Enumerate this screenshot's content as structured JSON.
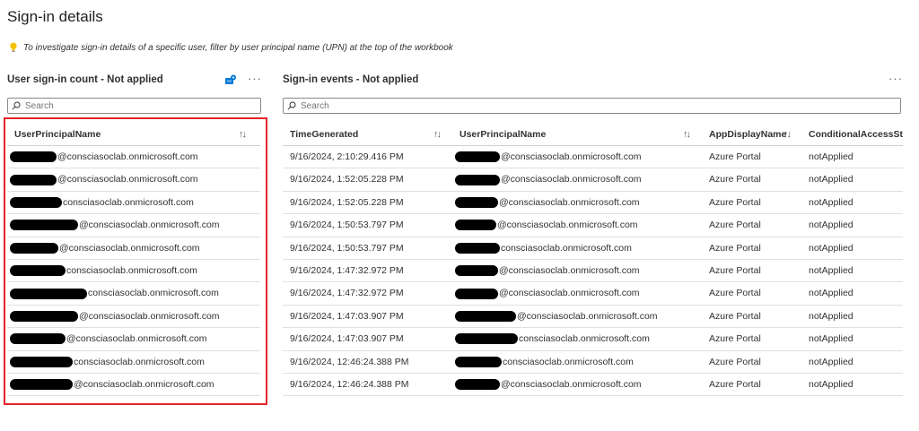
{
  "page": {
    "title": "Sign-in details",
    "tip": "To investigate sign-in details of a specific user, filter by user principal name (UPN) at the top of the workbook"
  },
  "left_panel": {
    "title": "User sign-in count - Not applied",
    "more": "···",
    "search_placeholder": "Search",
    "column": "UserPrincipalName",
    "sort_icon": "↑↓",
    "rows": [
      {
        "domain": "@consciasoclab.onmicrosoft.com"
      },
      {
        "domain": "@consciasoclab.onmicrosoft.com"
      },
      {
        "domain": "consciasoclab.onmicrosoft.com"
      },
      {
        "domain": "@consciasoclab.onmicrosoft.com"
      },
      {
        "domain": "@consciasoclab.onmicrosoft.com"
      },
      {
        "domain": "consciasoclab.onmicrosoft.com"
      },
      {
        "domain": "consciasoclab.onmicrosoft.com"
      },
      {
        "domain": "@consciasoclab.onmicrosoft.com"
      },
      {
        "domain": "@consciasoclab.onmicrosoft.com"
      },
      {
        "domain": "consciasoclab.onmicrosoft.com"
      },
      {
        "domain": "@consciasoclab.onmicrosoft.com"
      }
    ]
  },
  "right_panel": {
    "title": "Sign-in events - Not applied",
    "more": "···",
    "search_placeholder": "Search",
    "columns": {
      "time": "TimeGenerated",
      "upn": "UserPrincipalName",
      "app": "AppDisplayName",
      "ca": "ConditionalAccessStat"
    },
    "sort_icon": "↑↓",
    "rows": [
      {
        "time": "9/16/2024, 2:10:29.416 PM",
        "domain": "@consciasoclab.onmicrosoft.com",
        "app": "Azure Portal",
        "ca": "notApplied"
      },
      {
        "time": "9/16/2024, 1:52:05.228 PM",
        "domain": "@consciasoclab.onmicrosoft.com",
        "app": "Azure Portal",
        "ca": "notApplied"
      },
      {
        "time": "9/16/2024, 1:52:05.228 PM",
        "domain": "@consciasoclab.onmicrosoft.com",
        "app": "Azure Portal",
        "ca": "notApplied"
      },
      {
        "time": "9/16/2024, 1:50:53.797 PM",
        "domain": "@consciasoclab.onmicrosoft.com",
        "app": "Azure Portal",
        "ca": "notApplied"
      },
      {
        "time": "9/16/2024, 1:50:53.797 PM",
        "domain": "consciasoclab.onmicrosoft.com",
        "app": "Azure Portal",
        "ca": "notApplied"
      },
      {
        "time": "9/16/2024, 1:47:32.972 PM",
        "domain": "@consciasoclab.onmicrosoft.com",
        "app": "Azure Portal",
        "ca": "notApplied"
      },
      {
        "time": "9/16/2024, 1:47:32.972 PM",
        "domain": "@consciasoclab.onmicrosoft.com",
        "app": "Azure Portal",
        "ca": "notApplied"
      },
      {
        "time": "9/16/2024, 1:47:03.907 PM",
        "domain": "@consciasoclab.onmicrosoft.com",
        "app": "Azure Portal",
        "ca": "notApplied"
      },
      {
        "time": "9/16/2024, 1:47:03.907 PM",
        "domain": "consciasoclab.onmicrosoft.com",
        "app": "Azure Portal",
        "ca": "notApplied"
      },
      {
        "time": "9/16/2024, 12:46:24.388 PM",
        "domain": "consciasoclab.onmicrosoft.com",
        "app": "Azure Portal",
        "ca": "notApplied"
      },
      {
        "time": "9/16/2024, 12:46:24.388 PM",
        "domain": "@consciasoclab.onmicrosoft.com",
        "app": "Azure Portal",
        "ca": "notApplied"
      }
    ]
  },
  "colors": {
    "highlight": "#e3232b",
    "redaction": "#000000",
    "tip_icon": "#f2c200",
    "workspace_icon": "#0078d4"
  },
  "icons": {
    "tip": "lightbulb-icon",
    "workspace": "workspace-icon",
    "search": "search-icon"
  }
}
